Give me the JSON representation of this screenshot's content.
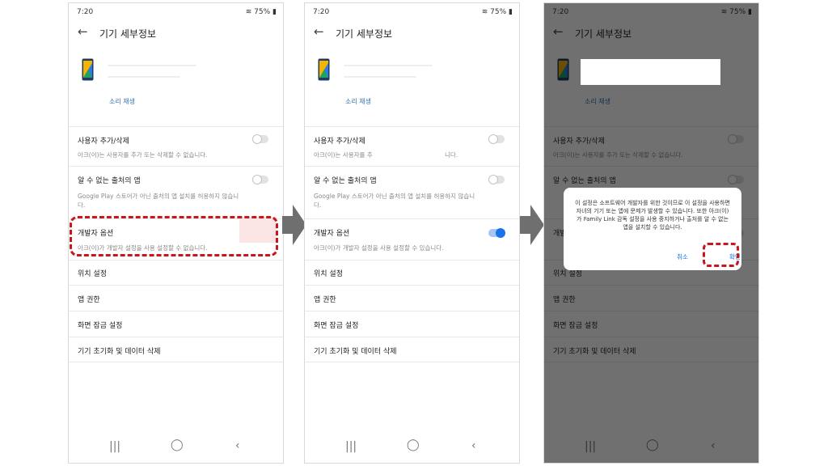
{
  "status": {
    "time": "7:20",
    "battery": "75%"
  },
  "header": {
    "title": "기기 세부정보"
  },
  "sound_label": "소리 재생",
  "rows": {
    "add_user": {
      "title": "사용자 추가/삭제",
      "desc": "아크(이)는 사용자를 추가 또는 삭제할 수 없습니다."
    },
    "unknown_apps": {
      "title": "알 수 없는 출처의 앱",
      "desc": "Google Play 스토어가 아닌 출처의 앱 설치를 허용하지 않습니다."
    },
    "developer_options": {
      "title": "개발자 옵션",
      "desc": "아크(이)가 개발자 설정을 사용 설정할 수 없습니다.",
      "desc_on": "아크(이)가 개발자 설정을 사용 설정할 수 있습니다."
    },
    "location": {
      "title": "위치 설정"
    },
    "app_permissions": {
      "title": "앱 권한"
    },
    "screen_lock": {
      "title": "화면 잠금 설정"
    },
    "factory_reset": {
      "title": "기기 초기화 및 데이터 삭제"
    }
  },
  "phone2_add_user_desc": {
    "part1": "아크(이)는 사용자를 추",
    "part2": "니다."
  },
  "dialog": {
    "message": "이 설정은 소프트웨어 개발자를 위한 것이므로 이 설정을 사용하면 자녀의 기기 또는 앱에 문제가 발생할 수 있습니다. 또한 아크(이)가 Family Link 감독 설정을 사용 중지하거나 출처를 알 수 없는 앱을 설치할 수 있습니다.",
    "cancel": "취소",
    "confirm": "확인"
  },
  "toggles": {
    "phone1_developer": false,
    "phone2_developer": true
  },
  "colors": {
    "accent": "#1a73e8",
    "callout": "#c8161d",
    "arrow": "#6f6f6f",
    "overlay": "#000000"
  },
  "icons": [
    "back-arrow-icon",
    "recent-apps-icon",
    "home-icon",
    "nav-back-icon",
    "phone-device-icon",
    "wifi-icon",
    "battery-icon"
  ]
}
